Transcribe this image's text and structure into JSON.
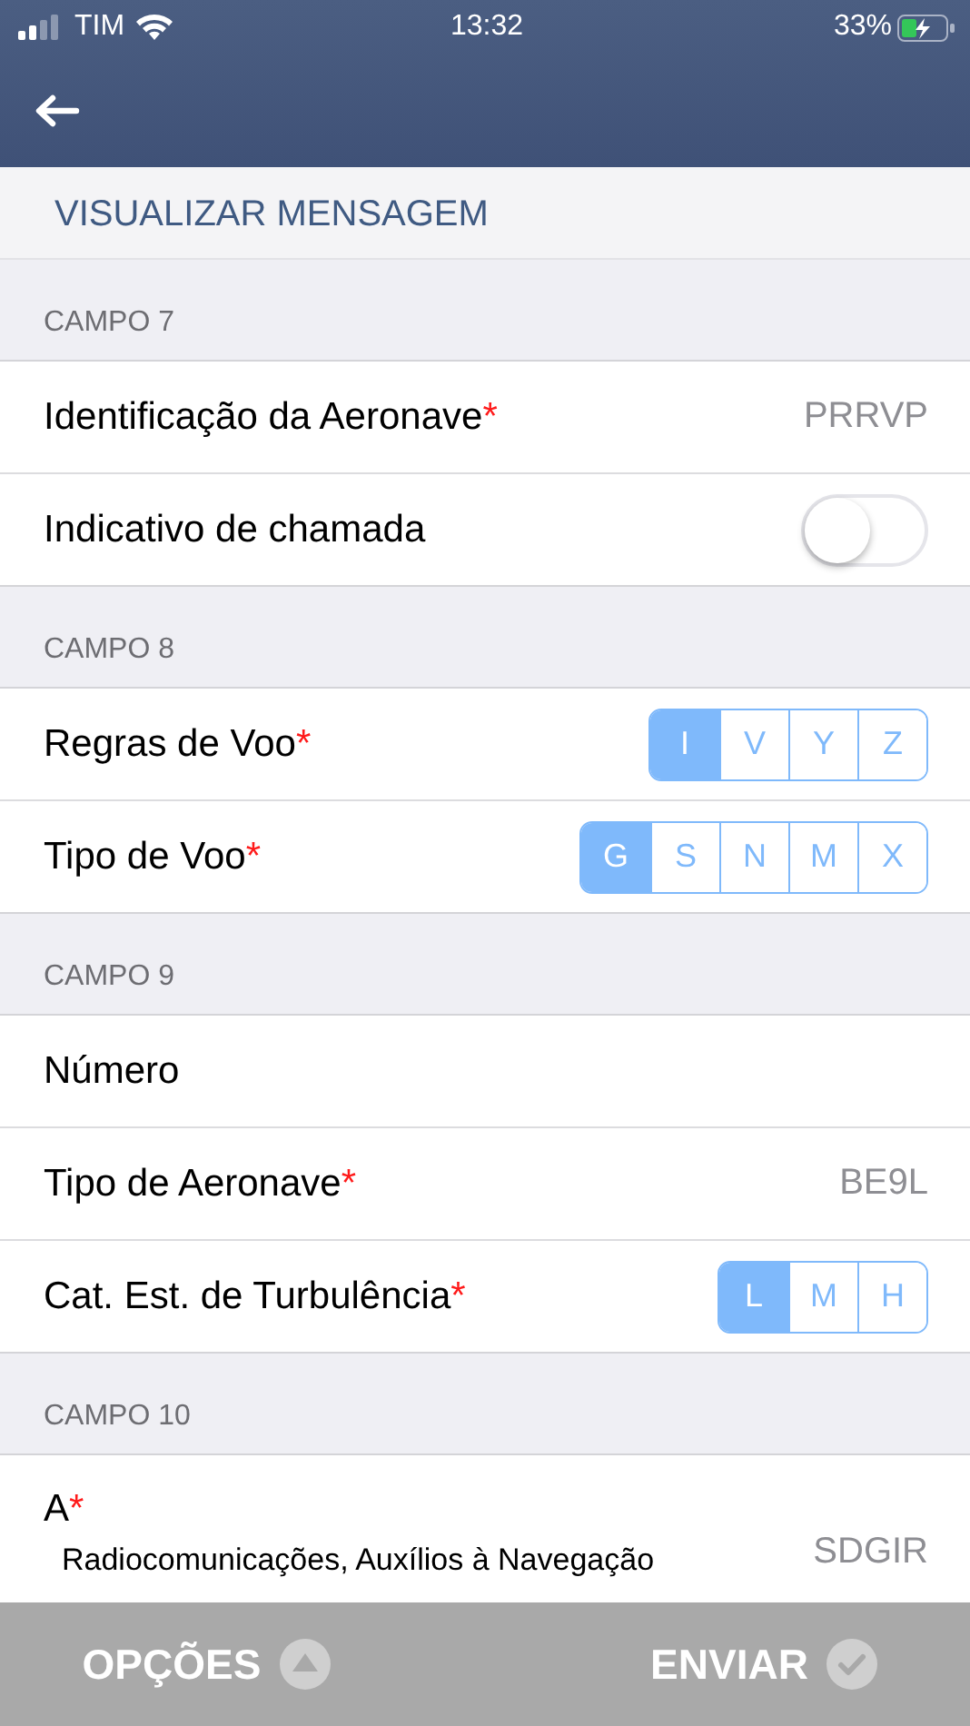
{
  "status_bar": {
    "carrier": "TIM",
    "time": "13:32",
    "battery": "33%"
  },
  "page_title": "VISUALIZAR MENSAGEM",
  "sections": [
    {
      "title": "CAMPO 7",
      "rows": [
        {
          "kind": "value",
          "label": "Identificação da Aeronave",
          "mark": "*",
          "value": "PRRVP"
        },
        {
          "kind": "toggle",
          "label": "Indicativo de chamada",
          "on": false
        }
      ]
    },
    {
      "title": "CAMPO 8",
      "rows": [
        {
          "kind": "segmented",
          "label": "Regras de Voo",
          "mark": "*",
          "options": [
            {
              "label": "I",
              "selected": true
            },
            {
              "label": "V",
              "selected": false
            },
            {
              "label": "Y",
              "selected": false
            },
            {
              "label": "Z",
              "selected": false
            }
          ]
        },
        {
          "kind": "segmented",
          "label": "Tipo de Voo",
          "mark": "*",
          "options": [
            {
              "label": "G",
              "selected": true
            },
            {
              "label": "S",
              "selected": false
            },
            {
              "label": "N",
              "selected": false
            },
            {
              "label": "M",
              "selected": false
            },
            {
              "label": "X",
              "selected": false
            }
          ]
        }
      ]
    },
    {
      "title": "CAMPO 9",
      "rows": [
        {
          "kind": "value",
          "label": "Número"
        },
        {
          "kind": "value",
          "label": "Tipo de Aeronave",
          "mark": "*",
          "value": "BE9L"
        },
        {
          "kind": "segmented",
          "label": "Cat. Est. de Turbulência",
          "mark": "*",
          "options": [
            {
              "label": "L",
              "selected": true
            },
            {
              "label": "M",
              "selected": false
            },
            {
              "label": "H",
              "selected": false
            }
          ]
        }
      ]
    },
    {
      "title": "CAMPO 10",
      "rows": [
        {
          "kind": "described",
          "label": "A",
          "mark": "*",
          "description": "Radiocomunicações, Auxílios à Navegação",
          "value": "SDGIR"
        }
      ]
    }
  ],
  "bottom_bar": [
    {
      "kind": "options",
      "label": "OPÇÕES"
    },
    {
      "kind": "send",
      "label": "ENVIAR"
    }
  ]
}
